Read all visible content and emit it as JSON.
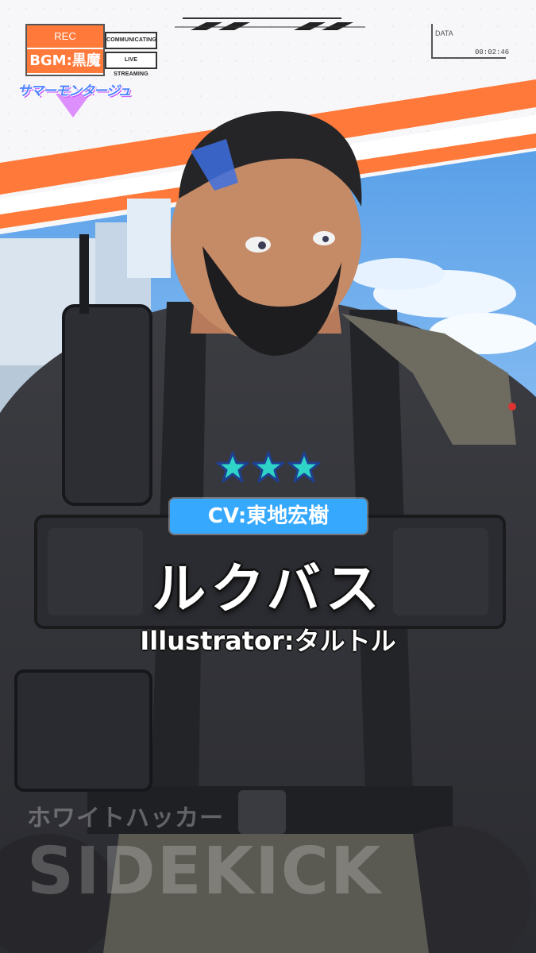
{
  "hud": {
    "rec_label": "REC",
    "bgm_label": "BGM:黒魔",
    "status_communicating": "COMMUNICATING",
    "status_streaming": "LIVE STREAMING",
    "data_label": "DATA",
    "timer": "00:02:46"
  },
  "event_logo": {
    "text": "サマーモンタージュ",
    "icon": "event-logo"
  },
  "character": {
    "rarity_stars": 3,
    "cv": "CV:東地宏樹",
    "name": "ルクバス",
    "illustrator": "Illustrator:タルトル",
    "class_jp": "ホワイトハッカー",
    "class_en": "SIDEKICK"
  },
  "colors": {
    "accent_orange": "#ff7a3a",
    "cv_badge": "#36a9ff",
    "star_fill": "#2fd3c8",
    "star_outline": "#1f3f8f"
  }
}
